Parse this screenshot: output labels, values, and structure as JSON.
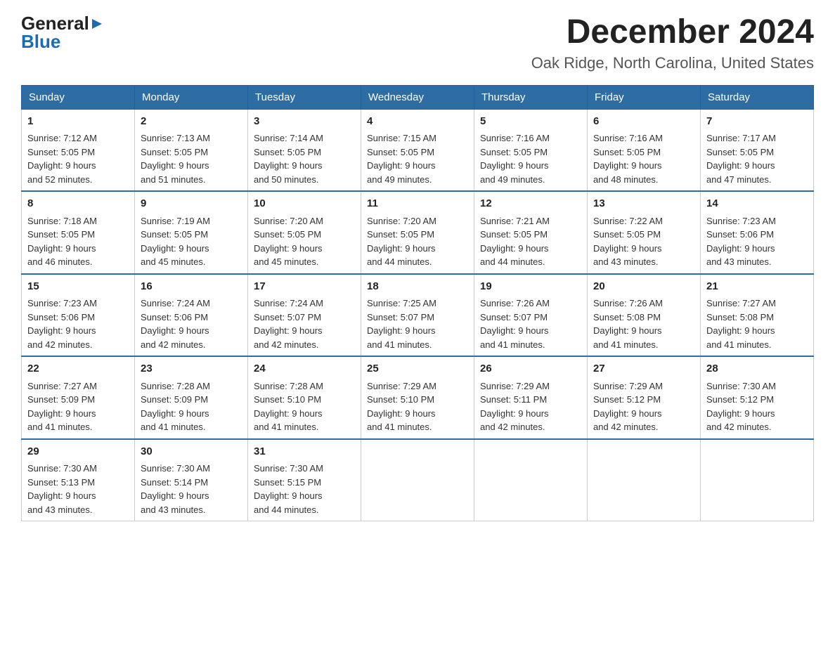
{
  "logo": {
    "general": "General",
    "blue": "Blue",
    "triangle": "▶"
  },
  "title": "December 2024",
  "subtitle": "Oak Ridge, North Carolina, United States",
  "days_of_week": [
    "Sunday",
    "Monday",
    "Tuesday",
    "Wednesday",
    "Thursday",
    "Friday",
    "Saturday"
  ],
  "weeks": [
    [
      {
        "day": "1",
        "sunrise": "7:12 AM",
        "sunset": "5:05 PM",
        "daylight": "9 hours and 52 minutes."
      },
      {
        "day": "2",
        "sunrise": "7:13 AM",
        "sunset": "5:05 PM",
        "daylight": "9 hours and 51 minutes."
      },
      {
        "day": "3",
        "sunrise": "7:14 AM",
        "sunset": "5:05 PM",
        "daylight": "9 hours and 50 minutes."
      },
      {
        "day": "4",
        "sunrise": "7:15 AM",
        "sunset": "5:05 PM",
        "daylight": "9 hours and 49 minutes."
      },
      {
        "day": "5",
        "sunrise": "7:16 AM",
        "sunset": "5:05 PM",
        "daylight": "9 hours and 49 minutes."
      },
      {
        "day": "6",
        "sunrise": "7:16 AM",
        "sunset": "5:05 PM",
        "daylight": "9 hours and 48 minutes."
      },
      {
        "day": "7",
        "sunrise": "7:17 AM",
        "sunset": "5:05 PM",
        "daylight": "9 hours and 47 minutes."
      }
    ],
    [
      {
        "day": "8",
        "sunrise": "7:18 AM",
        "sunset": "5:05 PM",
        "daylight": "9 hours and 46 minutes."
      },
      {
        "day": "9",
        "sunrise": "7:19 AM",
        "sunset": "5:05 PM",
        "daylight": "9 hours and 45 minutes."
      },
      {
        "day": "10",
        "sunrise": "7:20 AM",
        "sunset": "5:05 PM",
        "daylight": "9 hours and 45 minutes."
      },
      {
        "day": "11",
        "sunrise": "7:20 AM",
        "sunset": "5:05 PM",
        "daylight": "9 hours and 44 minutes."
      },
      {
        "day": "12",
        "sunrise": "7:21 AM",
        "sunset": "5:05 PM",
        "daylight": "9 hours and 44 minutes."
      },
      {
        "day": "13",
        "sunrise": "7:22 AM",
        "sunset": "5:05 PM",
        "daylight": "9 hours and 43 minutes."
      },
      {
        "day": "14",
        "sunrise": "7:23 AM",
        "sunset": "5:06 PM",
        "daylight": "9 hours and 43 minutes."
      }
    ],
    [
      {
        "day": "15",
        "sunrise": "7:23 AM",
        "sunset": "5:06 PM",
        "daylight": "9 hours and 42 minutes."
      },
      {
        "day": "16",
        "sunrise": "7:24 AM",
        "sunset": "5:06 PM",
        "daylight": "9 hours and 42 minutes."
      },
      {
        "day": "17",
        "sunrise": "7:24 AM",
        "sunset": "5:07 PM",
        "daylight": "9 hours and 42 minutes."
      },
      {
        "day": "18",
        "sunrise": "7:25 AM",
        "sunset": "5:07 PM",
        "daylight": "9 hours and 41 minutes."
      },
      {
        "day": "19",
        "sunrise": "7:26 AM",
        "sunset": "5:07 PM",
        "daylight": "9 hours and 41 minutes."
      },
      {
        "day": "20",
        "sunrise": "7:26 AM",
        "sunset": "5:08 PM",
        "daylight": "9 hours and 41 minutes."
      },
      {
        "day": "21",
        "sunrise": "7:27 AM",
        "sunset": "5:08 PM",
        "daylight": "9 hours and 41 minutes."
      }
    ],
    [
      {
        "day": "22",
        "sunrise": "7:27 AM",
        "sunset": "5:09 PM",
        "daylight": "9 hours and 41 minutes."
      },
      {
        "day": "23",
        "sunrise": "7:28 AM",
        "sunset": "5:09 PM",
        "daylight": "9 hours and 41 minutes."
      },
      {
        "day": "24",
        "sunrise": "7:28 AM",
        "sunset": "5:10 PM",
        "daylight": "9 hours and 41 minutes."
      },
      {
        "day": "25",
        "sunrise": "7:29 AM",
        "sunset": "5:10 PM",
        "daylight": "9 hours and 41 minutes."
      },
      {
        "day": "26",
        "sunrise": "7:29 AM",
        "sunset": "5:11 PM",
        "daylight": "9 hours and 42 minutes."
      },
      {
        "day": "27",
        "sunrise": "7:29 AM",
        "sunset": "5:12 PM",
        "daylight": "9 hours and 42 minutes."
      },
      {
        "day": "28",
        "sunrise": "7:30 AM",
        "sunset": "5:12 PM",
        "daylight": "9 hours and 42 minutes."
      }
    ],
    [
      {
        "day": "29",
        "sunrise": "7:30 AM",
        "sunset": "5:13 PM",
        "daylight": "9 hours and 43 minutes."
      },
      {
        "day": "30",
        "sunrise": "7:30 AM",
        "sunset": "5:14 PM",
        "daylight": "9 hours and 43 minutes."
      },
      {
        "day": "31",
        "sunrise": "7:30 AM",
        "sunset": "5:15 PM",
        "daylight": "9 hours and 44 minutes."
      },
      null,
      null,
      null,
      null
    ]
  ],
  "labels": {
    "sunrise": "Sunrise:",
    "sunset": "Sunset:",
    "daylight": "Daylight:"
  }
}
